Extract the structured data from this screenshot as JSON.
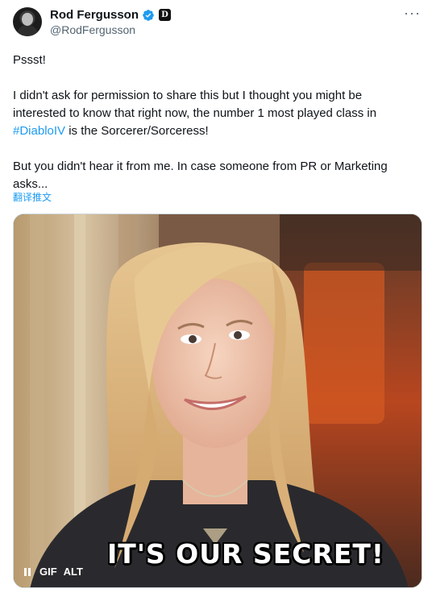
{
  "author": {
    "display_name": "Rod Fergusson",
    "handle": "@RodFergusson",
    "affiliate_badge": "D",
    "more_label": "···"
  },
  "tweet": {
    "p1": "Pssst!",
    "p2": "I didn't ask for permission to share this but I thought you might be interested to know that right now, the number 1 most played class in",
    "hashtag": "#DiabloIV",
    "p2_end": " is the Sorcerer/Sorceress!",
    "p3": "But you didn't hear it from me.  In case someone from PR or Marketing asks...",
    "translate": "翻译推文"
  },
  "media": {
    "caption": "IT'S OUR SECRET!",
    "gif_label": "GIF",
    "alt_label": "ALT"
  },
  "colors": {
    "link": "#1d9bf0",
    "verified": "#1d9bf0"
  }
}
